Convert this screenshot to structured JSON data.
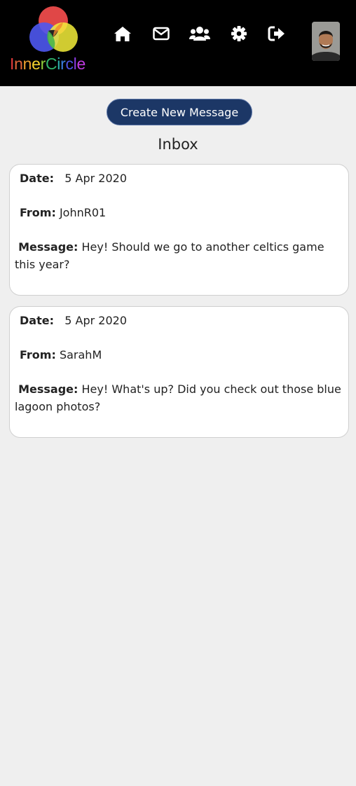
{
  "app": {
    "logo_text": "InnerCircle",
    "logo_letters": [
      "I",
      "n",
      "n",
      "e",
      "r",
      "C",
      "i",
      "r",
      "c",
      "l",
      "e"
    ],
    "logo_letter_colors": [
      "#e23b3b",
      "#e2683b",
      "#f0a330",
      "#f5d32e",
      "#8fcf3a",
      "#2fb36b",
      "#2fb3b0",
      "#3b7de2",
      "#4d52e2",
      "#8a3be2",
      "#c03be2"
    ]
  },
  "nav": {
    "items": [
      {
        "icon": "home-icon"
      },
      {
        "icon": "mail-icon"
      },
      {
        "icon": "users-icon"
      },
      {
        "icon": "gear-icon"
      },
      {
        "icon": "sign-out-icon"
      }
    ]
  },
  "actions": {
    "create_label": "Create New Message"
  },
  "inbox": {
    "title": "Inbox",
    "date_label": "Date:",
    "from_label": "From:",
    "message_label": "Message:",
    "messages": [
      {
        "date": "5 Apr 2020",
        "from": "JohnR01",
        "message": "Hey! Should we go to another celtics game this year?"
      },
      {
        "date": "5 Apr 2020",
        "from": "SarahM",
        "message": "Hey! What's up? Did you check out those blue lagoon photos?"
      }
    ]
  },
  "colors": {
    "header_bg": "#000000",
    "button_bg": "#1c3766",
    "page_bg": "#efefef"
  }
}
